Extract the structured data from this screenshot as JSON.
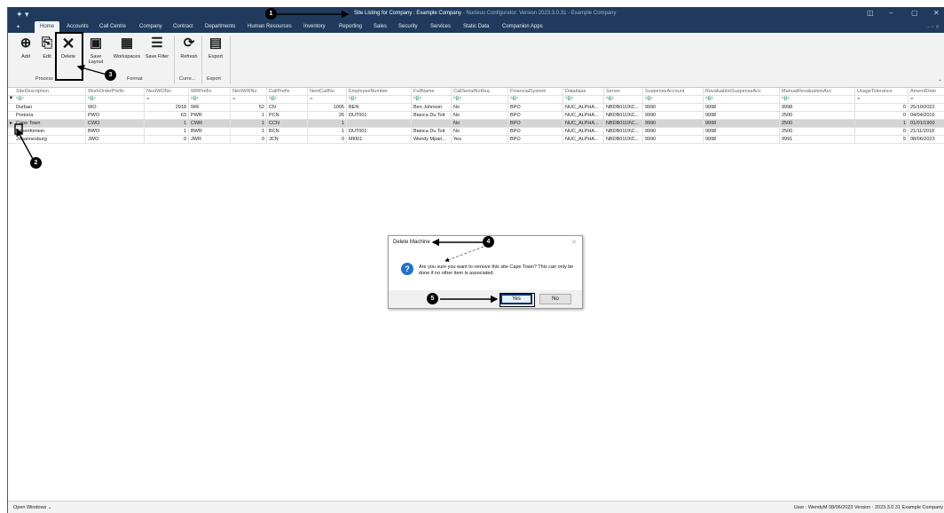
{
  "window": {
    "title": "Site Listing for Company : Example Company",
    "subtitle": " - Nucleus Configurator: Version 2023.3.0.31 - Example Company"
  },
  "menu": [
    "Home",
    "Accounts",
    "Call Centre",
    "Company",
    "Contract",
    "Departments",
    "Human Resources",
    "Inventory",
    "Reporting",
    "Sales",
    "Security",
    "Services",
    "Static Data",
    "Companion Apps"
  ],
  "ribbon": {
    "buttons": {
      "add": "Add",
      "edit": "Edit",
      "delete": "Delete",
      "save_layout": "Save Layout",
      "workspaces": "Workspaces",
      "save_filter": "Save Filter",
      "refresh": "Refresh",
      "export": "Export"
    },
    "groups": {
      "process": "Process",
      "format": "Format",
      "current": "Curre...",
      "export": "Export"
    }
  },
  "grid": {
    "columns": [
      "SiteDescription",
      "WorkOrderPrefix",
      "NextWONo",
      "WRPrefix",
      "NextWRNo",
      "CallPrefix",
      "NextCallNo",
      "EmployeeNumber",
      "FullName",
      "CallSerialNoReq",
      "FinancialSystem",
      "Database",
      "Server",
      "SuspenseAccount",
      "RevaluationSuspenseAcc",
      "ManualRevaluationAcc",
      "UsageTolerance",
      "AmendDate"
    ],
    "filter_marks": [
      "ᴬBᶜ",
      "ᴬBᶜ",
      "=",
      "ᴬBᶜ",
      "=",
      "ᴬBᶜ",
      "=",
      "ᴬBᶜ",
      "ᴬBᶜ",
      "ᴬBᶜ",
      "ᴬBᶜ",
      "ᴬBᶜ",
      "ᴬBᶜ",
      "ᴬBᶜ",
      "ᴬBᶜ",
      "ᴬBᶜ",
      "=",
      "="
    ],
    "rows": [
      [
        "Durban",
        "WO",
        "2918",
        "WR",
        "52",
        "CN",
        "1005",
        "BEN",
        "Ben Johnson",
        "No",
        "BPO",
        "NUC_ALPHA...",
        "NBDB0119\\C...",
        "9990",
        "9998",
        "9998",
        "0",
        "25/10/2022"
      ],
      [
        "Pretoria",
        "PWO",
        "63",
        "PWR",
        "1",
        "PCN",
        "26",
        "DUT001",
        "Bianca Du Toit",
        "No",
        "BPO",
        "NUC_ALPHA...",
        "NBDB0119\\C...",
        "9990",
        "9998",
        "2500",
        "0",
        "04/04/2016"
      ],
      [
        "Cape Town",
        "CWO",
        "1",
        "CWR",
        "1",
        "CCN",
        "1",
        "",
        "",
        "No",
        "BPO",
        "NUC_ALPHA...",
        "NBDB0119\\C...",
        "9990",
        "9998",
        "2500",
        "1",
        "01/01/1900"
      ],
      [
        "Bloemfontein",
        "BWO",
        "1",
        "BWR",
        "1",
        "BCN",
        "1",
        "DUT001",
        "Bianca Du Toit",
        "No",
        "BPO",
        "NUC_ALPHA...",
        "NBDB0119\\C...",
        "9990",
        "9998",
        "2500",
        "0",
        "21/11/2018"
      ],
      [
        "Johannesburg",
        "JWO",
        "0",
        "JWR",
        "0",
        "JCN",
        "0",
        "MI001",
        "Wendy Mpan...",
        "Yes",
        "BPO",
        "NUC_ALPHA...",
        "NBDB0119\\C...",
        "9990",
        "9998",
        "9991",
        "5",
        "08/06/2023"
      ]
    ],
    "selected_row": 2
  },
  "dialog": {
    "title": "Delete Machine",
    "message": "Are you sure you want to remove this site Cape Town? This can only be done if no other item is associated.",
    "yes": "Yes",
    "no": "No"
  },
  "status": {
    "open_windows": "Open Windows ⌄",
    "right": "User : WendyM  08/06/2023  Version : 2023.3.0.31  Example Company"
  },
  "callouts": [
    "1",
    "2",
    "3",
    "4",
    "5"
  ]
}
